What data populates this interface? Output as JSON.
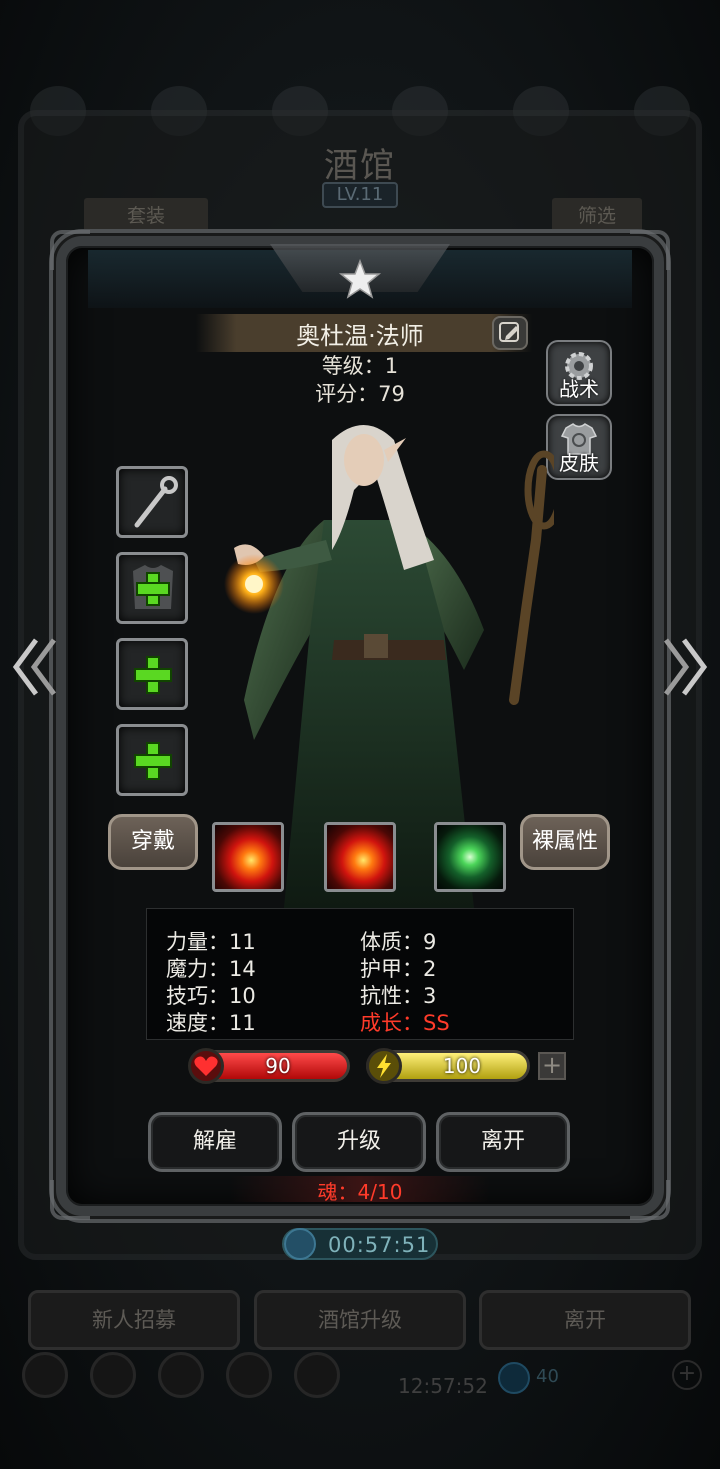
{
  "background": {
    "title": "酒馆",
    "level": "LV.11",
    "tab_left": "套装",
    "tab_right": "筛选",
    "timer": "00:57:51",
    "bottom_buttons": [
      "新人招募",
      "酒馆升级",
      "离开"
    ],
    "clock": "12:57:52",
    "coins": "40"
  },
  "hero": {
    "name": "奥杜温·法师",
    "level_text": "等级：1",
    "score_text": "评分：79"
  },
  "side_buttons": {
    "tactics": "战术",
    "skin": "皮肤"
  },
  "equipment_slots": [
    {
      "icon": "staff-icon",
      "filled": true
    },
    {
      "icon": "armor-plus-icon",
      "filled": false
    },
    {
      "icon": "plus-icon",
      "filled": false
    },
    {
      "icon": "plus-icon",
      "filled": false
    }
  ],
  "buttons": {
    "wear": "穿戴",
    "bare_attrs": "裸属性",
    "dismiss": "解雇",
    "upgrade": "升级",
    "leave": "离开"
  },
  "skills": [
    {
      "icon": "fire-skill-icon",
      "color": "#e8280f"
    },
    {
      "icon": "fire-skill-icon",
      "color": "#e8280f"
    },
    {
      "icon": "crystal-skill-icon",
      "color": "#4cd65a"
    }
  ],
  "stats": {
    "strength": "力量：11",
    "magic": "魔力：14",
    "skill": "技巧：10",
    "speed": "速度：11",
    "constitution": "体质：9",
    "armor": "护甲：2",
    "resistance": "抗性：3",
    "growth": "成长：SS"
  },
  "bars": {
    "hp": "90",
    "mp": "100",
    "hp_color": "#d41414",
    "mp_color": "#d8c81c"
  },
  "soul": "魂：4/10",
  "colors": {
    "accent_red": "#ff3b2a",
    "panel_border": "#3a3d3f",
    "name_bar": "#4a3e2d"
  }
}
